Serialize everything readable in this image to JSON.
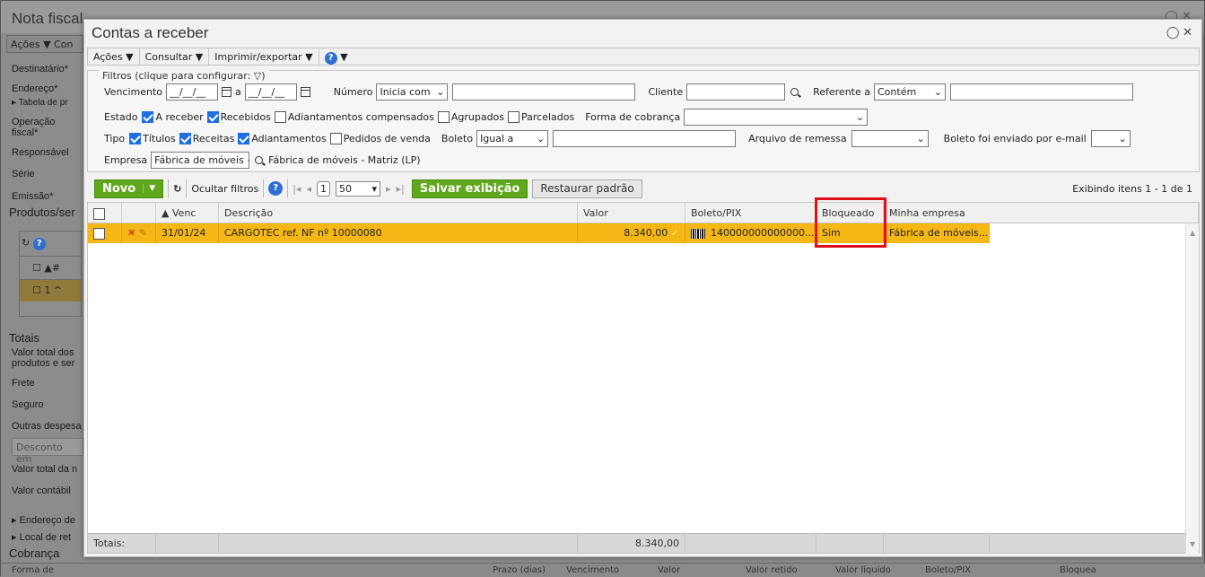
{
  "background": {
    "title": "Nota fiscal",
    "menu": "Ações ▼ Con",
    "fields": [
      "Destinatário*",
      "Endereço*",
      "▸ Tabela de pr",
      "Operação",
      "fiscal*",
      "Responsável",
      "Série",
      "Emissão*"
    ],
    "section_products": "Produtos/ser",
    "grid_row_num": "1 ^",
    "totals_title": "Totais",
    "totals_fields": [
      "Valor total dos",
      "produtos e ser",
      "Frete",
      "Seguro",
      "Outras despesa"
    ],
    "discount_placeholder": "Desconto em",
    "totals_fields2": [
      "Valor total da n",
      "Valor contábil"
    ],
    "address_fields": [
      "▸ Endereço de",
      "▸ Local de ret"
    ],
    "section_cobranca": "Cobrança",
    "forma_de": "Forma de",
    "bottom_cols": [
      "Prazo (dias)",
      "Vencimento",
      "Valor",
      "Valor retido",
      "Valor líquido",
      "Boleto/PIX",
      "Bloquea"
    ]
  },
  "modal": {
    "title": "Contas a receber",
    "menu": [
      "Ações ▼",
      "Consultar ▼",
      "Imprimir/exportar ▼"
    ],
    "help_icon": "?",
    "filters": {
      "legend": "Filtros (clique para configurar:",
      "vencimento_label": "Vencimento",
      "date_from": "__/__/__",
      "a_label": "a",
      "date_to": "__/__/__",
      "numero_label": "Número",
      "numero_op": "Inicia com",
      "cliente_label": "Cliente",
      "referente_label": "Referente a",
      "referente_op": "Contém",
      "estado_label": "Estado",
      "estado_opts": [
        {
          "label": "A receber",
          "checked": true
        },
        {
          "label": "Recebidos",
          "checked": true
        },
        {
          "label": "Adiantamentos compensados",
          "checked": false
        },
        {
          "label": "Agrupados",
          "checked": false
        },
        {
          "label": "Parcelados",
          "checked": false
        }
      ],
      "forma_cobranca_label": "Forma de cobrança",
      "tipo_label": "Tipo",
      "tipo_opts": [
        {
          "label": "Títulos",
          "checked": true
        },
        {
          "label": "Receitas",
          "checked": true
        },
        {
          "label": "Adiantamentos",
          "checked": true
        },
        {
          "label": "Pedidos de venda",
          "checked": false
        }
      ],
      "boleto_label": "Boleto",
      "boleto_op": "Igual a",
      "arquivo_label": "Arquivo de remessa",
      "boleto_email_label": "Boleto foi enviado por e-mail",
      "empresa_label": "Empresa",
      "empresa_value": "Fábrica de móveis -",
      "empresa_desc": "Fábrica de móveis - Matriz (LP)"
    },
    "toolbar": {
      "novo": "Novo",
      "ocultar": "Ocultar filtros",
      "page": "1",
      "page_size": "50",
      "salvar": "Salvar exibição",
      "restaurar": "Restaurar padrão",
      "exibindo": "Exibindo itens 1 - 1 de 1"
    },
    "grid": {
      "headers": [
        "",
        "",
        "▲ Venc",
        "Descrição",
        "Valor",
        "Boleto/PIX",
        "Bloqueado",
        "Minha empresa"
      ],
      "rows": [
        {
          "venc": "31/01/24",
          "descricao": "CARGOTEC ref. NF nº 10000080",
          "valor": "8.340,00",
          "boleto": "140000000000000...",
          "bloqueado": "Sim",
          "empresa": "Fábrica de móveis..."
        }
      ],
      "totais_label": "Totais:",
      "totais_valor": "8.340,00"
    }
  }
}
